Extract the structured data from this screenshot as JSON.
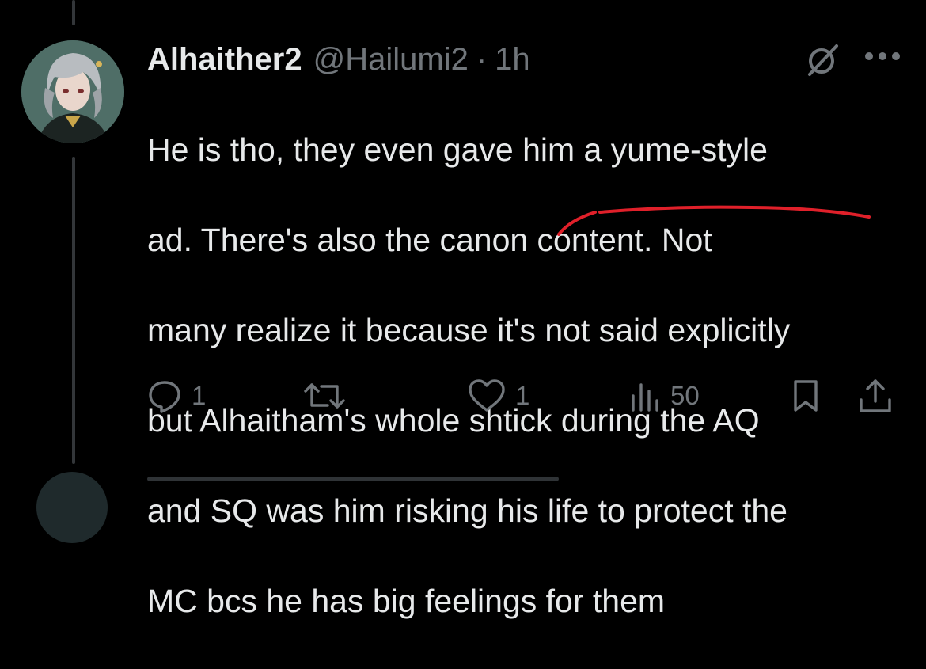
{
  "tweet": {
    "display_name": "Alhaither2",
    "handle": "@Hailumi2",
    "separator": "·",
    "time": "1h",
    "text_lines": [
      "He is tho, they even gave him a yume-style",
      "ad. There's also the canon content. Not",
      "many realize it because it's not said explicitly",
      "but Alhaitham's whole shtick during the AQ",
      "and SQ was him risking his life to protect the",
      "MC bcs he has big feelings for them"
    ],
    "stats": {
      "replies": "1",
      "retweets": "",
      "likes": "1",
      "views": "50"
    }
  },
  "icons": {
    "grok": "grok-icon",
    "more": "more-icon",
    "reply": "reply-icon",
    "retweet": "retweet-icon",
    "like": "heart-icon",
    "views": "views-icon",
    "bookmark": "bookmark-icon",
    "share": "share-icon"
  },
  "colors": {
    "background": "#000000",
    "text": "#e7e9ea",
    "muted": "#71767b",
    "annotation": "#e0202a"
  }
}
